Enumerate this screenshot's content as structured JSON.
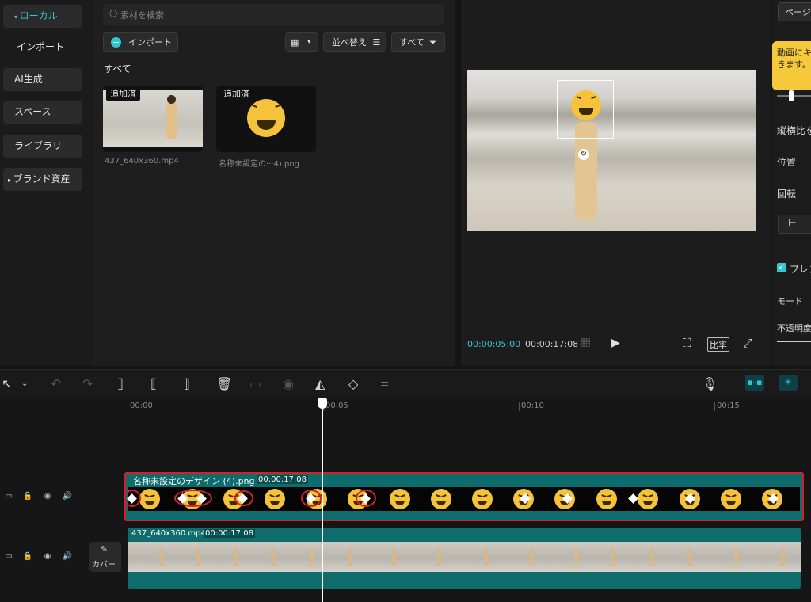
{
  "sidebar": {
    "items": [
      {
        "label": "ローカル",
        "active": true
      },
      {
        "label": "インポート"
      },
      {
        "label": "AI生成"
      },
      {
        "label": "スペース"
      },
      {
        "label": "ライブラリ"
      },
      {
        "label": "ブランド資産"
      }
    ]
  },
  "media": {
    "search_placeholder": "素材を検索",
    "import_label": "インポート",
    "sort_label": "並べ替え",
    "filter_label": "すべて",
    "section_title": "すべて",
    "items": [
      {
        "tag": "追加済",
        "name": "437_640x360.mp4"
      },
      {
        "tag": "追加済",
        "name": "名称未設定の···4).png"
      }
    ]
  },
  "preview": {
    "current_time": "00:00:05:00",
    "total_time": "00:00:17:08",
    "ratio_label": "比率"
  },
  "right_panel": {
    "page_btn": "ページ",
    "tooltip": "動画にキ\nきます。",
    "labels": [
      "縦横比を",
      "位置",
      "回転",
      "ブレン",
      "モード",
      "不透明度"
    ]
  },
  "timeline": {
    "ruler": [
      "00:00",
      "00:05",
      "00:10",
      "00:15"
    ],
    "cover_label": "カバー",
    "overlay_clip": {
      "name": "名称未設定のデザイン (4).png",
      "duration": "00:00:17:08"
    },
    "video_clip": {
      "name": "437_640x360.mp4",
      "duration": "00:00:17:08"
    }
  },
  "colors": {
    "accent": "#2fc7d3",
    "clip_teal": "#0e6c6c",
    "highlight": "#d4202a",
    "tooltip": "#f6c93b"
  }
}
